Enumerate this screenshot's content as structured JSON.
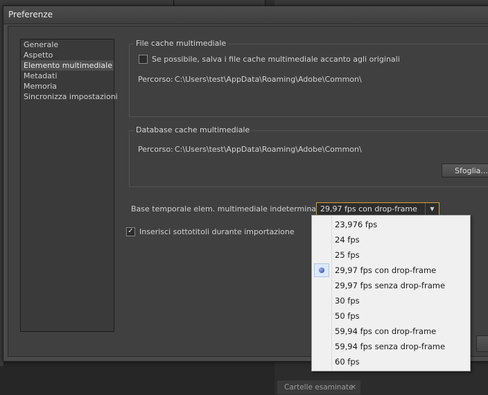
{
  "dialog": {
    "title": "Preferenze"
  },
  "nav": {
    "items": [
      {
        "label": "Generale"
      },
      {
        "label": "Aspetto"
      },
      {
        "label": "Elemento multimediale",
        "selected": true
      },
      {
        "label": "Metadati"
      },
      {
        "label": "Memoria"
      },
      {
        "label": "Sincronizza impostazioni"
      }
    ]
  },
  "file_cache": {
    "group_label": "File cache multimediale",
    "save_beside_label": "Se possibile, salva i file cache multimediale accanto agli originali",
    "save_beside_checked": false,
    "path_label": "Percorso:",
    "path_value": "C:\\Users\\test\\AppData\\Roaming\\Adobe\\Common\\"
  },
  "database_cache": {
    "group_label": "Database cache multimediale",
    "path_label": "Percorso:",
    "path_value": "C:\\Users\\test\\AppData\\Roaming\\Adobe\\Common\\",
    "browse_label": "Sfoglia..."
  },
  "timebase": {
    "label": "Base temporale elem. multimediale indeterminato:",
    "selected_value": "29,97 fps con drop-frame"
  },
  "captions": {
    "label": "Inserisci sottotitoli durante importazione",
    "checked": true
  },
  "dropdown": {
    "options": [
      "23,976 fps",
      "24 fps",
      "25 fps",
      "29,97 fps con drop-frame",
      "29,97 fps senza drop-frame",
      "30 fps",
      "50 fps",
      "59,94 fps con drop-frame",
      "59,94 fps senza drop-frame",
      "60 fps"
    ],
    "selected_index": 3
  },
  "background": {
    "panel_tab_label": "Cartelle esaminate"
  }
}
